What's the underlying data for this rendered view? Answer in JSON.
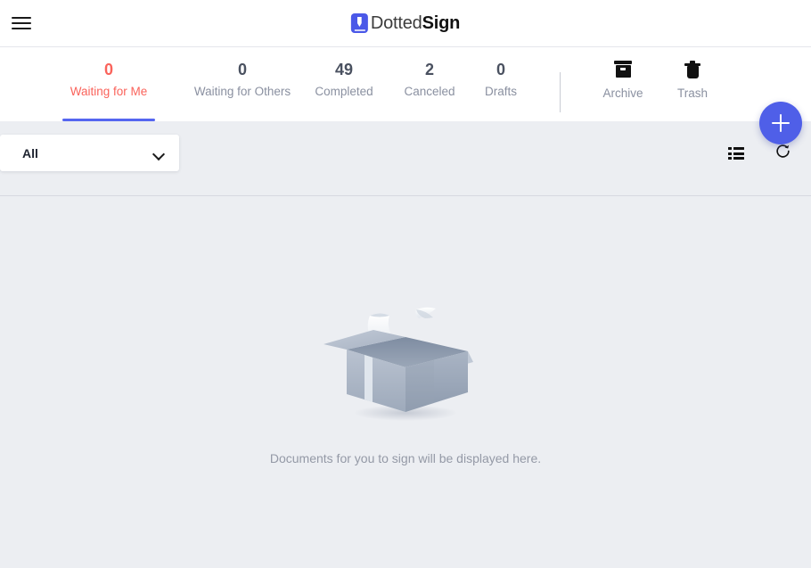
{
  "header": {
    "menu_icon": "hamburger-menu-icon",
    "brand_light": "Dotted",
    "brand_bold": "Sign",
    "brand_mark_color": "#4A58E8"
  },
  "tabs": {
    "active_index": 0,
    "active_color": "#FA635B",
    "underline_color": "#5566F0",
    "items": [
      {
        "count": "0",
        "label": "Waiting for Me"
      },
      {
        "count": "0",
        "label": "Waiting for Others"
      },
      {
        "count": "49",
        "label": "Completed"
      },
      {
        "count": "2",
        "label": "Canceled"
      },
      {
        "count": "0",
        "label": "Drafts"
      }
    ],
    "icon_items": [
      {
        "label": "Archive",
        "icon": "archive-box-icon"
      },
      {
        "label": "Trash",
        "icon": "trash-can-icon"
      }
    ]
  },
  "toolbar": {
    "filter": {
      "selected": "All",
      "chevron_icon": "chevron-down-icon"
    },
    "list_view_icon": "list-view-icon",
    "refresh_icon": "refresh-icon"
  },
  "fab": {
    "icon": "plus-icon",
    "color": "#4F5FE8"
  },
  "empty_state": {
    "illustration": "empty-open-box-illustration",
    "message": "Documents for you to sign will be displayed here."
  }
}
